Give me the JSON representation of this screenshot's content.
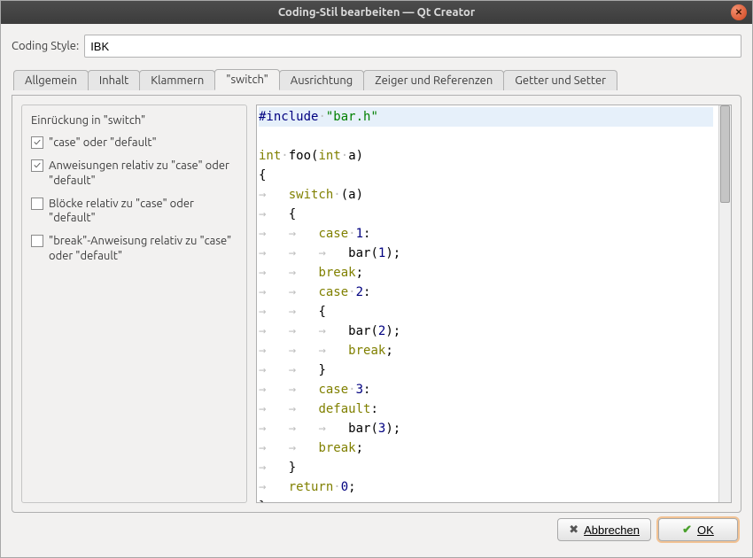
{
  "window": {
    "title": "Coding-Stil bearbeiten — Qt Creator"
  },
  "field": {
    "label": "Coding Style:",
    "value": "IBK"
  },
  "tabs": [
    {
      "label": "Allgemein"
    },
    {
      "label": "Inhalt"
    },
    {
      "label": "Klammern"
    },
    {
      "label": "\"switch\""
    },
    {
      "label": "Ausrichtung"
    },
    {
      "label": "Zeiger und Referenzen"
    },
    {
      "label": "Getter und Setter"
    }
  ],
  "group": {
    "title": "Einrückung in \"switch\"",
    "options": [
      {
        "checked": true,
        "label": "\"case\" oder \"default\""
      },
      {
        "checked": true,
        "label": "Anweisungen relativ zu \"case\" oder \"default\""
      },
      {
        "checked": false,
        "label": "Blöcke relativ zu \"case\" oder \"default\""
      },
      {
        "checked": false,
        "label": "\"break\"-Anweisung relativ zu \"case\" oder \"default\""
      }
    ]
  },
  "code": {
    "include_kw": "#include",
    "include_str": "\"bar.h\"",
    "int": "int",
    "foo": "foo",
    "open_paren": "(",
    "close_paren": ")",
    "a": "a",
    "obrace": "{",
    "cbrace": "}",
    "switch": "switch",
    "case": "case",
    "default": "default",
    "break": "break",
    "return": "return",
    "zero": "0",
    "one": "1",
    "two": "2",
    "three": "3",
    "bar": "bar",
    "colon": ":",
    "semi": ";"
  },
  "buttons": {
    "cancel": "Abbrechen",
    "ok": "OK"
  }
}
